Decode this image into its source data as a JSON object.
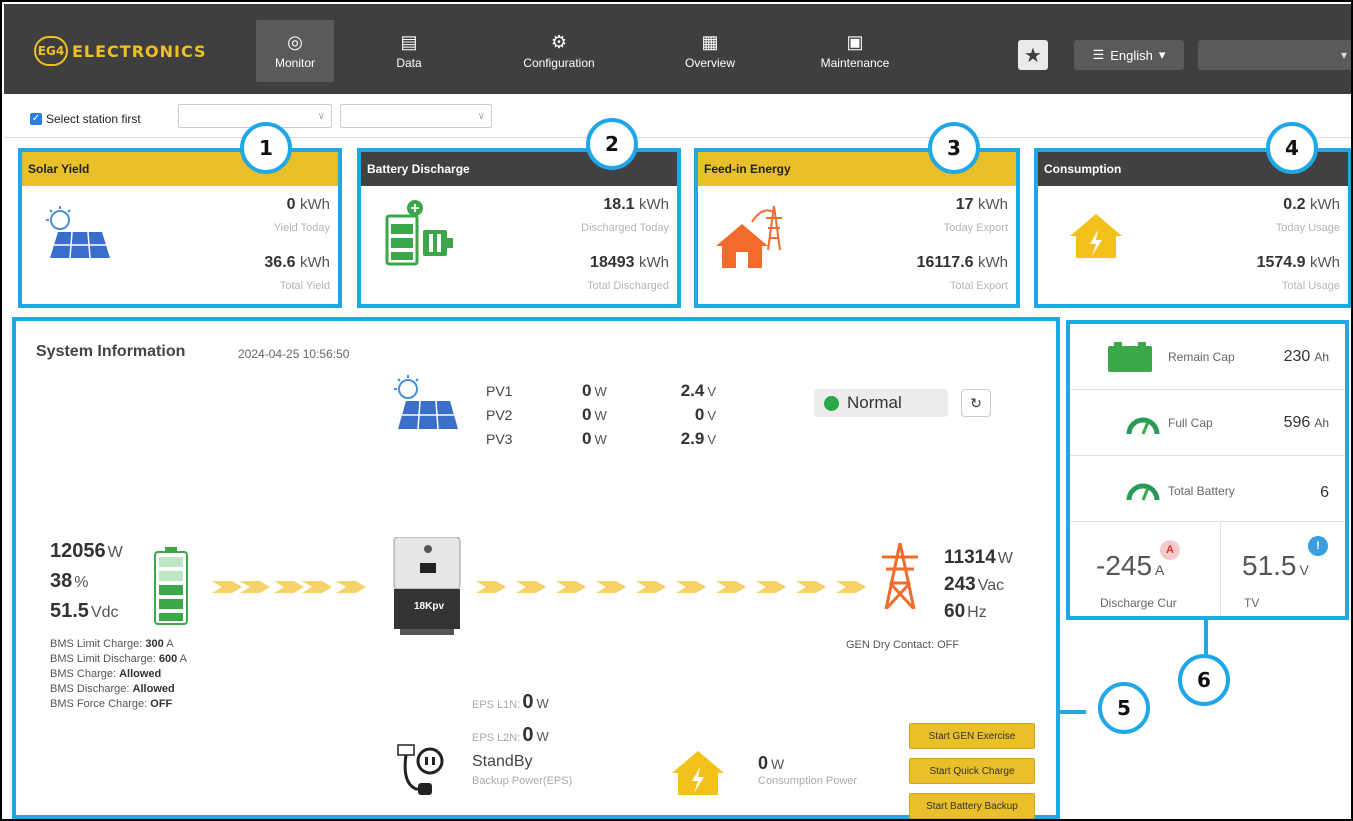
{
  "nav": {
    "logo_badge": "EG4",
    "logo_text": "ELECTRONICS",
    "items": [
      {
        "label": "Monitor",
        "icon": "compass-icon"
      },
      {
        "label": "Data",
        "icon": "database-icon"
      },
      {
        "label": "Configuration",
        "icon": "gear-icon"
      },
      {
        "label": "Overview",
        "icon": "grid-icon"
      },
      {
        "label": "Maintenance",
        "icon": "briefcase-icon"
      }
    ],
    "language": "English"
  },
  "station": {
    "select_label": "Select station first"
  },
  "cards": {
    "solar": {
      "title": "Solar Yield",
      "today_value": "0",
      "today_unit": "kWh",
      "today_label": "Yield Today",
      "total_value": "36.6",
      "total_unit": "kWh",
      "total_label": "Total Yield"
    },
    "battery": {
      "title": "Battery Discharge",
      "today_value": "18.1",
      "today_unit": "kWh",
      "today_label": "Discharged Today",
      "total_value": "18493",
      "total_unit": "kWh",
      "total_label": "Total Discharged"
    },
    "feedin": {
      "title": "Feed-in Energy",
      "today_value": "17",
      "today_unit": "kWh",
      "today_label": "Today Export",
      "total_value": "16117.6",
      "total_unit": "kWh",
      "total_label": "Total Export"
    },
    "consumption": {
      "title": "Consumption",
      "today_value": "0.2",
      "today_unit": "kWh",
      "today_label": "Today Usage",
      "total_value": "1574.9",
      "total_unit": "kWh",
      "total_label": "Total Usage"
    }
  },
  "callouts": [
    "1",
    "2",
    "3",
    "4",
    "5",
    "6"
  ],
  "system": {
    "title": "System Information",
    "timestamp": "2024-04-25 10:56:50",
    "pv": [
      {
        "name": "PV1",
        "power": "0",
        "power_unit": "W",
        "voltage": "2.4",
        "voltage_unit": "V"
      },
      {
        "name": "PV2",
        "power": "0",
        "power_unit": "W",
        "voltage": "0",
        "voltage_unit": "V"
      },
      {
        "name": "PV3",
        "power": "0",
        "power_unit": "W",
        "voltage": "2.9",
        "voltage_unit": "V"
      }
    ],
    "status": "Normal",
    "inverter_label": "18Kpv",
    "battery": {
      "power": "12056",
      "power_unit": "W",
      "soc": "38",
      "soc_unit": "%",
      "voltage": "51.5",
      "voltage_unit": "Vdc",
      "bms": [
        {
          "label": "BMS Limit Charge:",
          "value": "300",
          "unit": "A"
        },
        {
          "label": "BMS Limit Discharge:",
          "value": "600",
          "unit": "A"
        },
        {
          "label": "BMS Charge:",
          "value": "Allowed",
          "unit": ""
        },
        {
          "label": "BMS Discharge:",
          "value": "Allowed",
          "unit": ""
        },
        {
          "label": "BMS Force Charge:",
          "value": "OFF",
          "unit": ""
        }
      ]
    },
    "grid": {
      "power": "11314",
      "power_unit": "W",
      "voltage": "243",
      "voltage_unit": "Vac",
      "freq": "60",
      "freq_unit": "Hz",
      "gen_dry": "GEN Dry Contact: OFF"
    },
    "eps": {
      "l1_label": "EPS L1N:",
      "l1_value": "0",
      "l1_unit": "W",
      "l2_label": "EPS L2N:",
      "l2_value": "0",
      "l2_unit": "W",
      "status": "StandBy",
      "label": "Backup Power(EPS)"
    },
    "consumption": {
      "value": "0",
      "unit": "W",
      "label": "Consumption Power"
    },
    "buttons": [
      "Start GEN Exercise",
      "Start Quick Charge",
      "Start Battery Backup"
    ]
  },
  "battery_panel": {
    "remain_cap": {
      "label": "Remain Cap",
      "value": "230",
      "unit": "Ah"
    },
    "full_cap": {
      "label": "Full Cap",
      "value": "596",
      "unit": "Ah"
    },
    "total_battery": {
      "label": "Total Battery",
      "value": "6"
    },
    "discharge_cur": {
      "value": "-245",
      "unit": "A",
      "label": "Discharge Cur",
      "badge": "A"
    },
    "tv": {
      "value": "51.5",
      "unit": "V",
      "label": "TV",
      "badge": "!"
    }
  },
  "colors": {
    "accent_blue": "#1fa7e6",
    "brand_yellow": "#e9bf2a",
    "nav_dark": "#3f3f3f",
    "status_green": "#2aa84a"
  }
}
